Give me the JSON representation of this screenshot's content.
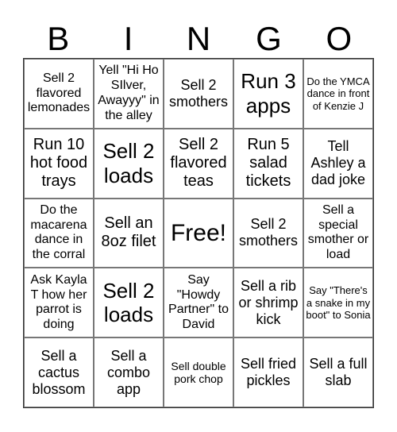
{
  "header": {
    "letters": [
      "B",
      "I",
      "N",
      "G",
      "O"
    ]
  },
  "cells": [
    {
      "text": "Sell 2 flavored lemonades",
      "size": "s-md"
    },
    {
      "text": "Yell \"Hi Ho SIlver, Awayyy\" in the alley",
      "size": "s-md"
    },
    {
      "text": "Sell 2 smothers",
      "size": "s-lg"
    },
    {
      "text": "Run 3 apps",
      "size": "s-xxl"
    },
    {
      "text": "Do the YMCA dance in front of Kenzie J",
      "size": "s-xs"
    },
    {
      "text": "Run 10 hot food trays",
      "size": "s-xl"
    },
    {
      "text": "Sell 2 loads",
      "size": "s-xxl"
    },
    {
      "text": "Sell 2 flavored teas",
      "size": "s-xl"
    },
    {
      "text": "Run 5 salad tickets",
      "size": "s-xl"
    },
    {
      "text": "Tell Ashley a dad joke",
      "size": "s-lg"
    },
    {
      "text": "Do the macarena dance in the corral",
      "size": "s-md"
    },
    {
      "text": "Sell an 8oz filet",
      "size": "s-xl"
    },
    {
      "text": "Free!",
      "size": "s-xxxl"
    },
    {
      "text": "Sell 2 smothers",
      "size": "s-lg"
    },
    {
      "text": "Sell a special smother or load",
      "size": "s-md"
    },
    {
      "text": "Ask Kayla T how her parrot is doing",
      "size": "s-md"
    },
    {
      "text": "Sell 2 loads",
      "size": "s-xxl"
    },
    {
      "text": "Say \"Howdy Partner\" to David",
      "size": "s-md"
    },
    {
      "text": "Sell a rib or shrimp kick",
      "size": "s-lg"
    },
    {
      "text": "Say \"There's a snake in my boot\" to Sonia",
      "size": "s-xs"
    },
    {
      "text": "Sell a cactus blossom",
      "size": "s-lg"
    },
    {
      "text": "Sell a combo app",
      "size": "s-lg"
    },
    {
      "text": "Sell double pork chop",
      "size": "s-sm"
    },
    {
      "text": "Sell fried pickles",
      "size": "s-lg"
    },
    {
      "text": "Sell a full slab",
      "size": "s-lg"
    }
  ]
}
